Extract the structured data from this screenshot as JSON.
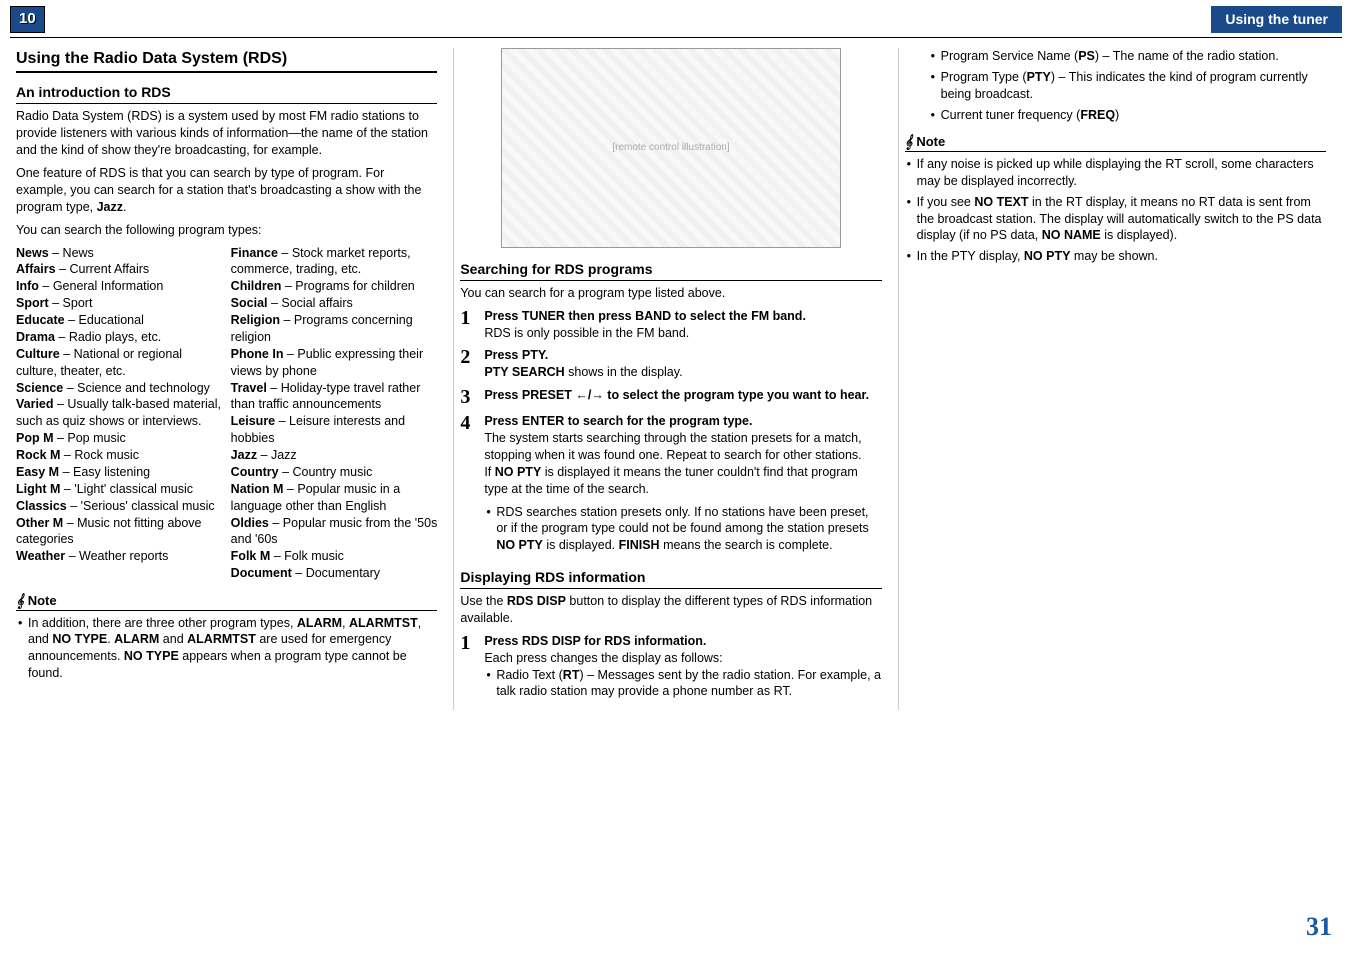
{
  "header": {
    "chapter_num": "10",
    "section_title": "Using the tuner"
  },
  "col1": {
    "h1": "Using the Radio Data System (RDS)",
    "h2_intro": "An introduction to RDS",
    "intro_p1": "Radio Data System (RDS) is a system used by most FM radio stations to provide listeners with various kinds of information—the name of the station and the kind of show they're broadcasting, for example.",
    "intro_p2_a": "One feature of RDS is that you can search by type of program. For example, you can search for a station that's broadcasting a show with the program type, ",
    "intro_p2_jazz": "Jazz",
    "intro_p3": "You can search the following program types:",
    "types_left": [
      {
        "name": "News",
        "desc": " – News"
      },
      {
        "name": "Affairs",
        "desc": " – Current Affairs"
      },
      {
        "name": "Info",
        "desc": " – General Information"
      },
      {
        "name": "Sport",
        "desc": " – Sport"
      },
      {
        "name": "Educate",
        "desc": " – Educational"
      },
      {
        "name": "Drama",
        "desc": " – Radio plays, etc."
      },
      {
        "name": "Culture",
        "desc": " – National or regional culture, theater, etc."
      },
      {
        "name": "Science",
        "desc": " – Science and technology"
      },
      {
        "name": "Varied",
        "desc": " – Usually talk-based material, such as quiz shows or interviews."
      },
      {
        "name": "Pop M",
        "desc": " – Pop music"
      },
      {
        "name": "Rock M",
        "desc": " – Rock music"
      },
      {
        "name": "Easy M",
        "desc": " – Easy listening"
      },
      {
        "name": "Light M",
        "desc": " – 'Light' classical music"
      },
      {
        "name": "Classics",
        "desc": " – 'Serious' classical music"
      },
      {
        "name": "Other M",
        "desc": " – Music not fitting above categories"
      },
      {
        "name": "Weather",
        "desc": " – Weather reports"
      }
    ],
    "types_right": [
      {
        "name": "Finance",
        "desc": " – Stock market reports, commerce, trading, etc."
      },
      {
        "name": "Children",
        "desc": " – Programs for children"
      },
      {
        "name": "Social",
        "desc": " – Social affairs"
      },
      {
        "name": "Religion",
        "desc": " – Programs concerning religion"
      },
      {
        "name": "Phone In",
        "desc": " – Public expressing their views by phone"
      },
      {
        "name": "Travel",
        "desc": " – Holiday-type travel rather than traffic announcements"
      },
      {
        "name": "Leisure",
        "desc": " – Leisure interests and hobbies"
      },
      {
        "name": "Jazz",
        "desc": " – Jazz"
      },
      {
        "name": "Country",
        "desc": " – Country music"
      },
      {
        "name": "Nation M",
        "desc": " – Popular music in a language other than English"
      },
      {
        "name": "Oldies",
        "desc": " – Popular music from the '50s and '60s"
      },
      {
        "name": "Folk M",
        "desc": " – Folk music"
      },
      {
        "name": "Document",
        "desc": " – Documentary"
      }
    ],
    "note_label": "Note",
    "note1_a": "In addition, there are three other program types, ",
    "note1_alarm": "ALARM",
    "note1_comma": ", ",
    "note1_alarmtst": "ALARMTST",
    "note1_and": ", and ",
    "note1_notype": "NO TYPE",
    "note1_b": ". ",
    "note1_alarm2": "ALARM",
    "note1_and2": " and ",
    "note1_alarmtst2": "ALARMTST",
    "note1_c": " are used for emergency announcements. ",
    "note1_notype2": "NO TYPE",
    "note1_d": " appears when a program type cannot be found."
  },
  "col2": {
    "remote_placeholder": "[remote control illustration]",
    "h2_search": "Searching for RDS programs",
    "search_intro": "You can search for a program type listed above.",
    "step1_title": "Press TUNER then press BAND to select the FM band.",
    "step1_body": "RDS is only possible in the FM band.",
    "step2_title": "Press PTY.",
    "step2_b": "PTY SEARCH",
    "step2_body": " shows in the display.",
    "step3_title_a": "Press PRESET ",
    "step3_arrows": "←/→",
    "step3_title_b": " to select the program type you want to hear.",
    "step4_title": "Press ENTER to search for the program type.",
    "step4_body": "The system starts searching through the station presets for a match, stopping when it was found one. Repeat to search for other stations.",
    "step4_p2_a": "If ",
    "step4_nopty": "NO PTY",
    "step4_p2_b": " is displayed it means the tuner couldn't find that program type at the time of the search.",
    "step4_bullet_a": "RDS searches station presets only. If no stations have been preset, or if the program type could not be found among the station presets ",
    "step4_bullet_nopty": "NO PTY",
    "step4_bullet_b": " is displayed. ",
    "step4_bullet_finish": "FINISH",
    "step4_bullet_c": " means the search is complete.",
    "h2_disp": "Displaying RDS information",
    "disp_intro_a": "Use the ",
    "disp_rdsdisp": "RDS DISP",
    "disp_intro_b": " button to display the different types of RDS information available.",
    "disp_step1_title": "Press RDS DISP for RDS information.",
    "disp_step1_body": "Each press changes the display as follows:",
    "disp_rt_a": "Radio Text (",
    "disp_rt_b": "RT",
    "disp_rt_c": ") – Messages sent by the radio station. For example, a talk radio station may provide a phone number as RT."
  },
  "col3": {
    "ps_a": "Program Service Name (",
    "ps_b": "PS",
    "ps_c": ") – The name of the radio station.",
    "pty_a": "Program Type (",
    "pty_b": "PTY",
    "pty_c": ") – This indicates the kind of program currently being broadcast.",
    "freq_a": "Current tuner frequency (",
    "freq_b": "FREQ",
    "freq_c": ")",
    "note_label": "Note",
    "n1": "If any noise is picked up while displaying the RT scroll, some characters may be displayed incorrectly.",
    "n2_a": "If you see ",
    "n2_b": "NO TEXT",
    "n2_c": " in the RT display, it means no RT data is sent from the broadcast station. The display will automatically switch to the PS data display (if no PS data, ",
    "n2_d": "NO NAME",
    "n2_e": " is displayed).",
    "n3_a": "In the PTY display, ",
    "n3_b": "NO PTY",
    "n3_c": " may be shown."
  },
  "page_num": "31"
}
